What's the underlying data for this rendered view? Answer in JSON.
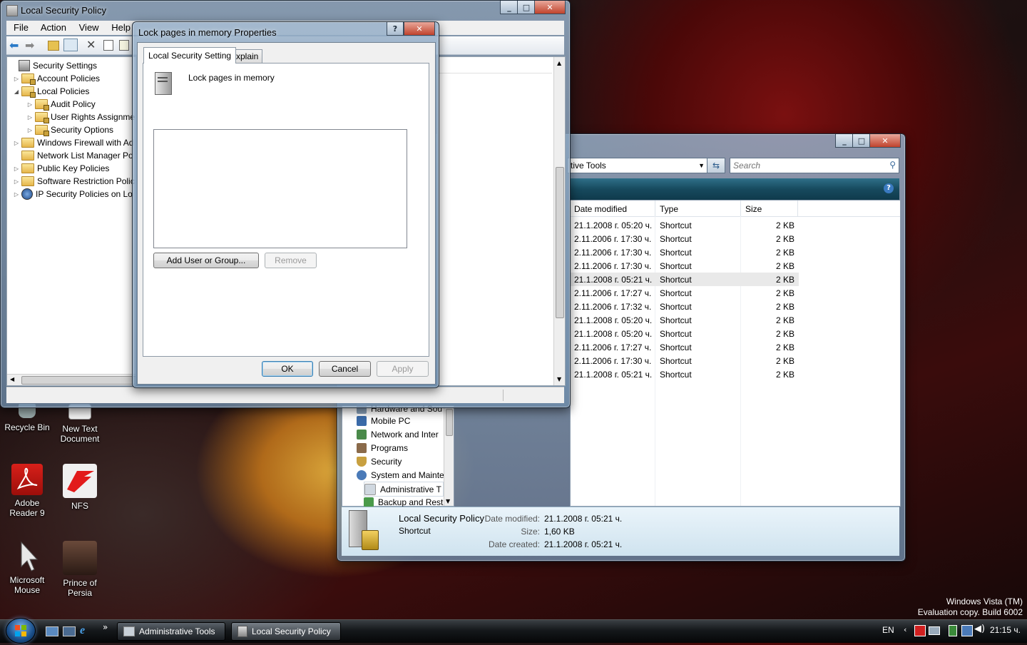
{
  "colors": {
    "accent": "#1e5f8a",
    "taskbar": "#0c0c0c",
    "selection": "#e9e9e9"
  },
  "desktop": {
    "icons": [
      {
        "name": "recycle-bin",
        "label": "Recycle Bin"
      },
      {
        "name": "new-text-document",
        "label": "New Text Document"
      },
      {
        "name": "adobe-reader",
        "label": "Adobe Reader 9"
      },
      {
        "name": "nfs",
        "label": "NFS"
      },
      {
        "name": "microsoft-mouse",
        "label": "Microsoft Mouse"
      },
      {
        "name": "prince-of-persia",
        "label": "Prince of Persia"
      }
    ],
    "watermark_line1": "Windows Vista (TM)",
    "watermark_line2": "Evaluation copy. Build 6002"
  },
  "lsp": {
    "title": "Local Security Policy",
    "menu": [
      "File",
      "Action",
      "View",
      "Help"
    ],
    "tree": [
      {
        "label": "Security Settings",
        "level": 0,
        "expander": ""
      },
      {
        "label": "Account Policies",
        "level": 1,
        "expander": "▷"
      },
      {
        "label": "Local Policies",
        "level": 1,
        "expander": "◢"
      },
      {
        "label": "Audit Policy",
        "level": 2,
        "expander": "▷"
      },
      {
        "label": "User Rights Assignme",
        "level": 2,
        "expander": "▷"
      },
      {
        "label": "Security Options",
        "level": 2,
        "expander": "▷"
      },
      {
        "label": "Windows Firewall with Ad",
        "level": 1,
        "expander": "▷"
      },
      {
        "label": "Network List Manager Po",
        "level": 1,
        "expander": ""
      },
      {
        "label": "Public Key Policies",
        "level": 1,
        "expander": "▷"
      },
      {
        "label": "Software Restriction Polic",
        "level": 1,
        "expander": "▷"
      },
      {
        "label": "IP Security Policies on Lo",
        "level": 1,
        "expander": "▷"
      }
    ]
  },
  "dialog": {
    "title": "Lock pages in memory Properties",
    "tabs": [
      "Local Security Setting",
      "Explain"
    ],
    "policy_name": "Lock pages in memory",
    "add_button": "Add User or Group...",
    "remove_button": "Remove",
    "ok": "OK",
    "cancel": "Cancel",
    "apply": "Apply",
    "help_glyph": "?"
  },
  "explorer": {
    "address_text": "tive Tools",
    "search_placeholder": "Search",
    "columns": [
      "Date modified",
      "Type",
      "Size"
    ],
    "rows": [
      {
        "date": "21.1.2008 г. 05:20 ч.",
        "type": "Shortcut",
        "size": "2 KB"
      },
      {
        "date": "2.11.2006 г. 17:30 ч.",
        "type": "Shortcut",
        "size": "2 KB"
      },
      {
        "date": "2.11.2006 г. 17:30 ч.",
        "type": "Shortcut",
        "size": "2 KB"
      },
      {
        "date": "2.11.2006 г. 17:30 ч.",
        "type": "Shortcut",
        "size": "2 KB"
      },
      {
        "date": "21.1.2008 г. 05:21 ч.",
        "type": "Shortcut",
        "size": "2 KB",
        "selected": true
      },
      {
        "date": "2.11.2006 г. 17:27 ч.",
        "type": "Shortcut",
        "size": "2 KB"
      },
      {
        "date": "2.11.2006 г. 17:32 ч.",
        "type": "Shortcut",
        "size": "2 KB"
      },
      {
        "date": "21.1.2008 г. 05:20 ч.",
        "type": "Shortcut",
        "size": "2 KB"
      },
      {
        "date": "21.1.2008 г. 05:20 ч.",
        "type": "Shortcut",
        "size": "2 KB"
      },
      {
        "date": "2.11.2006 г. 17:27 ч.",
        "type": "Shortcut",
        "size": "2 KB"
      },
      {
        "date": "2.11.2006 г. 17:30 ч.",
        "type": "Shortcut",
        "size": "2 KB"
      },
      {
        "date": "21.1.2008 г. 05:21 ч.",
        "type": "Shortcut",
        "size": "2 KB"
      }
    ],
    "sidebar": [
      {
        "label": "Hardware and Sou",
        "icon": "#8aa0b8"
      },
      {
        "label": "Mobile PC",
        "icon": "#3a6aa8"
      },
      {
        "label": "Network and Inter",
        "icon": "#4a8a4a"
      },
      {
        "label": "Programs",
        "icon": "#8a6a4a"
      },
      {
        "label": "Security",
        "icon": "#c8a040"
      },
      {
        "label": "System and Mainte",
        "icon": "#4a7ab8"
      },
      {
        "label": "Administrative T",
        "icon": "#d0d8e0",
        "indent": true
      },
      {
        "label": "Backup and Rest",
        "icon": "#4a9a4a",
        "indent": true
      }
    ],
    "details": {
      "name": "Local Security Policy",
      "kind": "Shortcut",
      "date_modified_label": "Date modified:",
      "date_modified": "21.1.2008 г. 05:21 ч.",
      "size_label": "Size:",
      "size": "1,60 KB",
      "date_created_label": "Date created:",
      "date_created": "21.1.2008 г. 05:21 ч."
    }
  },
  "taskbar": {
    "chevron": "»",
    "buttons": [
      "Administrative Tools",
      "Local Security Policy"
    ],
    "lang": "EN",
    "time": "21:15 ч."
  }
}
